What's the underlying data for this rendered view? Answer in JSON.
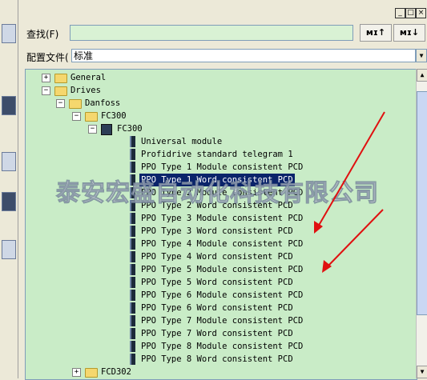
{
  "window": {
    "minimize": "_",
    "restore": "□",
    "close": "×"
  },
  "search": {
    "label": "查找(F)",
    "value": "",
    "find_down": "ᴍɪ↓",
    "find_up": "ᴍɪ↑"
  },
  "profile": {
    "label": "配置文件(",
    "value": "标准"
  },
  "tree": {
    "nodes": [
      {
        "label": "General",
        "expander": "+",
        "level": 0,
        "icon": "folder-icon"
      },
      {
        "label": "Drives",
        "expander": "−",
        "level": 0,
        "icon": "folder-icon"
      },
      {
        "label": "Danfoss",
        "expander": "−",
        "level": 1,
        "icon": "folder-icon"
      },
      {
        "label": "FC300",
        "expander": "−",
        "level": 2,
        "icon": "folder-icon"
      },
      {
        "label": "FC300",
        "expander": "−",
        "level": 3,
        "icon": "device-icon"
      },
      {
        "label": "Universal module",
        "level": 4,
        "icon": "module-icon"
      },
      {
        "label": "Profidrive standard telegram 1",
        "level": 4,
        "icon": "module-icon"
      },
      {
        "label": "PPO Type 1 Module consistent PCD",
        "level": 4,
        "icon": "module-icon"
      },
      {
        "label": "PPO Type 1 Word consistent PCD",
        "level": 4,
        "icon": "module-icon",
        "selected": true
      },
      {
        "label": "PPO Type 2 Module consistent PCD",
        "level": 4,
        "icon": "module-icon"
      },
      {
        "label": "PPO Type 2 Word consistent PCD",
        "level": 4,
        "icon": "module-icon"
      },
      {
        "label": "PPO Type 3 Module consistent PCD",
        "level": 4,
        "icon": "module-icon"
      },
      {
        "label": "PPO Type 3 Word consistent PCD",
        "level": 4,
        "icon": "module-icon"
      },
      {
        "label": "PPO Type 4 Module consistent PCD",
        "level": 4,
        "icon": "module-icon"
      },
      {
        "label": "PPO Type 4 Word consistent PCD",
        "level": 4,
        "icon": "module-icon"
      },
      {
        "label": "PPO Type 5 Module consistent PCD",
        "level": 4,
        "icon": "module-icon"
      },
      {
        "label": "PPO Type 5 Word consistent PCD",
        "level": 4,
        "icon": "module-icon"
      },
      {
        "label": "PPO Type 6 Module consistent PCD",
        "level": 4,
        "icon": "module-icon"
      },
      {
        "label": "PPO Type 6 Word consistent PCD",
        "level": 4,
        "icon": "module-icon"
      },
      {
        "label": "PPO Type 7 Module consistent PCD",
        "level": 4,
        "icon": "module-icon"
      },
      {
        "label": "PPO Type 7 Word consistent PCD",
        "level": 4,
        "icon": "module-icon"
      },
      {
        "label": "PPO Type 8 Module consistent PCD",
        "level": 4,
        "icon": "module-icon"
      },
      {
        "label": "PPO Type 8 Word consistent PCD",
        "level": 4,
        "icon": "module-icon"
      },
      {
        "label": "FCD302",
        "expander": "+",
        "level": 2,
        "icon": "folder-icon"
      }
    ]
  },
  "watermark": "泰安宏盛自动化科技有限公司",
  "scrollbar": {
    "up": "▲",
    "down": "▼"
  },
  "colors": {
    "tree_bg": "#c9ecc7",
    "selection": "#0a246a",
    "arrow": "#e01010"
  }
}
